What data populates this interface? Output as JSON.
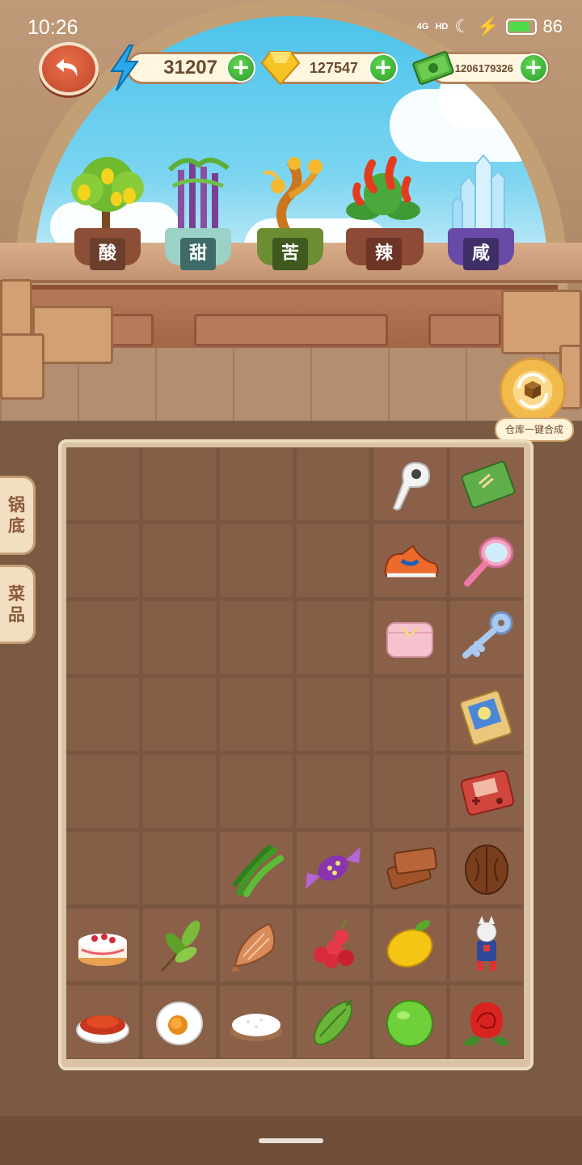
{
  "status_bar": {
    "time": "10:26",
    "network": "4G",
    "hd": "HD",
    "battery": "86",
    "battery_level": 0.86
  },
  "resources": {
    "energy": "31207",
    "gems": "127547",
    "cash": "1206179326",
    "plus": "+"
  },
  "flavors": [
    {
      "label": "酸",
      "icon": "lemon-tree-icon"
    },
    {
      "label": "甜",
      "icon": "sugarcane-icon"
    },
    {
      "label": "苦",
      "icon": "bitter-gourd-plant-icon"
    },
    {
      "label": "辣",
      "icon": "chili-plant-icon"
    },
    {
      "label": "咸",
      "icon": "salt-crystal-icon"
    }
  ],
  "merge_button": {
    "label": "仓库一键合成",
    "icon": "warehouse-merge-icon"
  },
  "side_tabs": [
    {
      "label": "锅\n底",
      "chars": [
        "锅",
        "底"
      ]
    },
    {
      "label": "菜\n品",
      "chars": [
        "菜",
        "品"
      ]
    }
  ],
  "grid": {
    "rows": [
      [
        "",
        "",
        "",
        "",
        "earbud-icon",
        "notebook-icon"
      ],
      [
        "",
        "",
        "",
        "",
        "sneaker-icon",
        "hand-mirror-icon"
      ],
      [
        "",
        "",
        "",
        "",
        "pink-purse-icon",
        "key-icon"
      ],
      [
        "",
        "",
        "",
        "",
        "",
        "trading-card-icon"
      ],
      [
        "",
        "",
        "",
        "",
        "",
        "game-console-icon"
      ],
      [
        "",
        "",
        "green-chili-icon",
        "candy-icon",
        "toast-icon",
        "walnut-icon"
      ],
      [
        "cake-icon",
        "tea-leaf-icon",
        "dried-fish-icon",
        "lychee-icon",
        "lemon-icon",
        "toy-figure-icon"
      ],
      [
        "chili-powder-icon",
        "salted-egg-icon",
        "salt-bowl-icon",
        "bitter-melon-icon",
        "lime-icon",
        "rose-icon"
      ]
    ]
  }
}
